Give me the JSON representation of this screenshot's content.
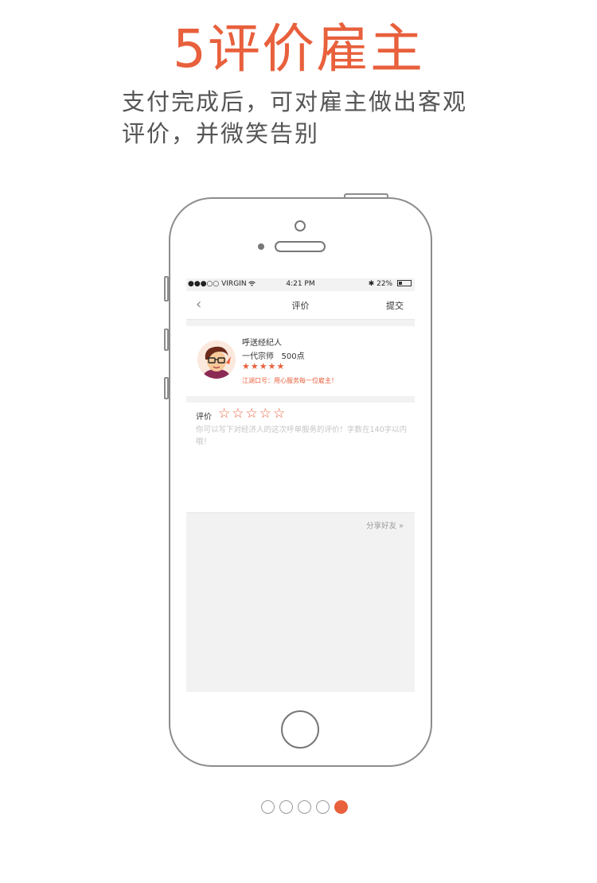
{
  "headline": "5评价雇主",
  "subtitle": "支付完成后，可对雇主做出客观评价，并微笑告别",
  "status_bar": {
    "carrier": "●●●○○ VIRGIN",
    "wifi_icon": "wifi-icon",
    "time": "4:21 PM",
    "bluetooth": "✱",
    "battery": "22%"
  },
  "nav": {
    "back_icon": "‹",
    "title": "评价",
    "submit": "提交"
  },
  "profile": {
    "name": "呼送经纪人",
    "rank": "一代宗师   500点",
    "stars_filled": 5,
    "stars_text": "★★★★★",
    "slogan": "江湖口号：用心服务每一位雇主！"
  },
  "rating": {
    "label": "评价",
    "stars_text": "☆☆☆☆☆",
    "stars_selected": 0,
    "placeholder": "你可以写下对经济人的这次呼单服务的评价！字数在140字以内哦！"
  },
  "share": "分享好友 »",
  "pager": {
    "total": 5,
    "current": 5
  },
  "colors": {
    "accent": "#e8603c",
    "text": "#555555",
    "gray_bg": "#f2f2f2"
  }
}
